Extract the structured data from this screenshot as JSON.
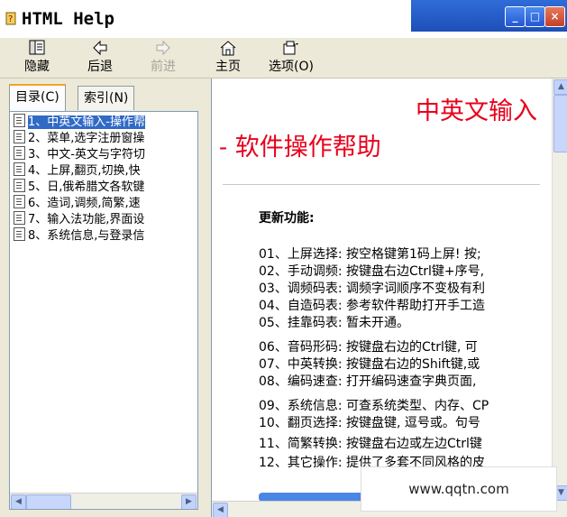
{
  "window": {
    "title": "HTML Help",
    "minimize": "_",
    "maximize": "□",
    "close": "×"
  },
  "toolbar": {
    "items": [
      {
        "label": "隐藏",
        "icon": "hide-icon",
        "enabled": true
      },
      {
        "label": "后退",
        "icon": "back-arrow-icon",
        "enabled": true
      },
      {
        "label": "前进",
        "icon": "forward-arrow-icon",
        "enabled": false
      },
      {
        "label": "主页",
        "icon": "home-icon",
        "enabled": true
      },
      {
        "label": "选项(O)",
        "icon": "options-icon",
        "enabled": true
      }
    ]
  },
  "tabs": [
    {
      "label": "目录(C)",
      "active": true
    },
    {
      "label": "索引(N)",
      "active": false
    }
  ],
  "tree": {
    "items": [
      "1、中英文输入-操作帮",
      "2、菜单,选字注册窗操",
      "3、中文-英文与字符切",
      "4、上屏,翻页,切换,快",
      "5、日,俄希腊文各软键",
      "6、造词,调频,简繁,速",
      "7、输入法功能,界面设",
      "8、系统信息,与登录信"
    ],
    "selected_index": 0
  },
  "content": {
    "title_line1": "中英文输入",
    "title_line2": "- 软件操作帮助",
    "section_heading": "更新功能:",
    "features": [
      "01、上屏选择: 按空格键第1码上屏! 按;",
      "02、手动调频: 按键盘右边Ctrl键+序号,",
      "03、调频码表: 调频字词顺序不变极有利",
      "04、自造码表: 参考软件帮助打开手工造",
      "05、挂靠码表: 暂未开通。",
      "06、音码形码: 按键盘右边的Ctrl键, 可",
      "07、中英转换: 按键盘右边的Shift键,或",
      "08、编码速查: 打开编码速查字典页面,",
      "09、系统信息: 可查系统类型、内存、CP",
      "10、翻页选择: 按键盘键, 逗号或。句号",
      "11、简繁转换: 按键盘右边或左边Ctrl键",
      "12、其它操作: 提供了多套不同风格的皮"
    ]
  },
  "watermark": "www.qqtn.com"
}
